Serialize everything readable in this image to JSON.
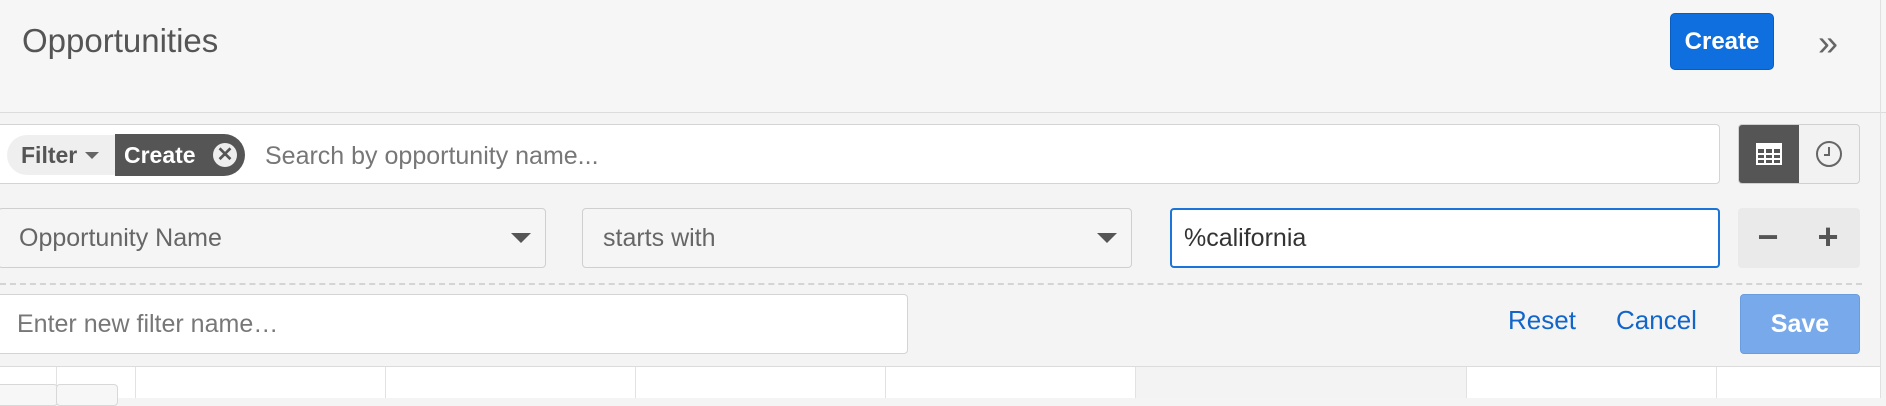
{
  "header": {
    "title": "Opportunities",
    "create_label": "Create",
    "collapse_icon": "»"
  },
  "search": {
    "filter_label": "Filter",
    "active_filter_tag": "Create",
    "tag_close_icon": "✕",
    "placeholder": "Search by opportunity name..."
  },
  "view_toggle": {
    "active": "table",
    "icons": [
      "table-icon",
      "clock-icon"
    ]
  },
  "filter_rule": {
    "field": "Opportunity Name",
    "operator": "starts with",
    "value": "%california",
    "remove_label": "−",
    "add_label": "+"
  },
  "filter_actions": {
    "name_placeholder": "Enter new filter name…",
    "reset_label": "Reset",
    "cancel_label": "Cancel",
    "save_label": "Save"
  },
  "colors": {
    "primary": "#0f6fde",
    "link": "#1266c9",
    "save_disabled": "#78a9ea",
    "dark_tag": "#555555"
  }
}
